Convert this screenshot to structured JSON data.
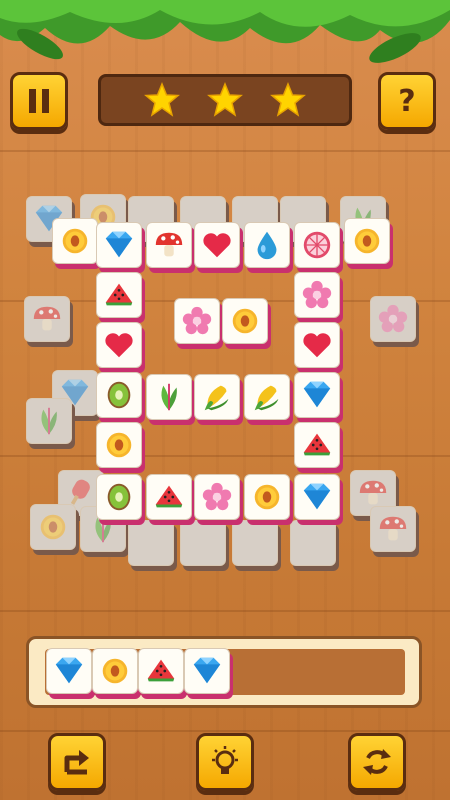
{
  "game": {
    "stars": 3,
    "pause_icon": "pause-icon",
    "help_label": "?",
    "buttons": [
      "undo-icon",
      "hint-lightbulb-icon",
      "shuffle-icon"
    ]
  },
  "colors": {
    "button": "#f5a800",
    "tile_edge": "#c9306e",
    "star": "#ffd400",
    "tray": "#fbeac4"
  },
  "board": {
    "top_tiles": [
      "diamond",
      "mushroom",
      "heart",
      "water-drop",
      "lemon-slice",
      "watermelon",
      "flower",
      "peach",
      "flower",
      "heart",
      "heart",
      "kiwi",
      "leaves",
      "corn",
      "corn",
      "diamond",
      "peach",
      "watermelon",
      "kiwi",
      "watermelon",
      "flower",
      "peach",
      "diamond"
    ],
    "lower_tiles": [
      "diamond",
      "peach",
      "leaf",
      "mushroom",
      "flower",
      "diamond",
      "leaves",
      "ice-pop",
      "mushroom",
      "peach",
      "leaves",
      "mushroom"
    ]
  },
  "tray": {
    "slots": [
      "diamond",
      "peach",
      "watermelon",
      "diamond"
    ],
    "capacity": 7
  }
}
